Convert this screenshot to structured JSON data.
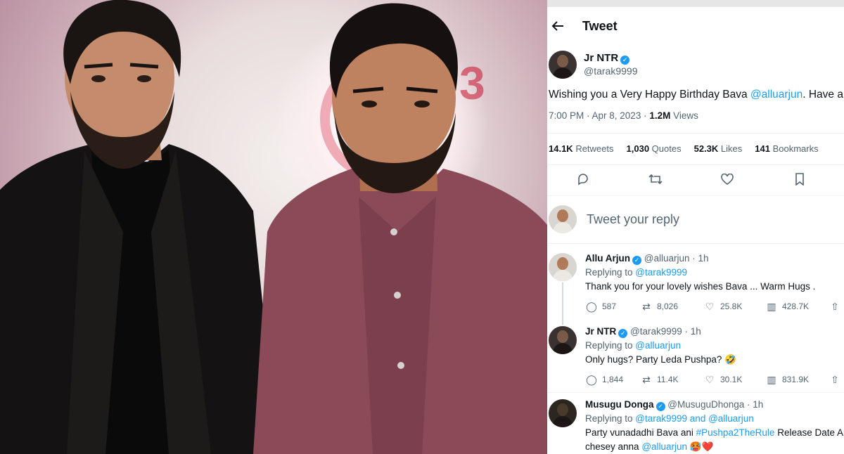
{
  "header": {
    "title": "Tweet"
  },
  "tweet": {
    "author_name": "Jr NTR",
    "author_handle": "@tarak9999",
    "text_prefix": "Wishing you a Very Happy Birthday Bava ",
    "text_mention": "@alluarjun",
    "text_suffix": ". Have a gre",
    "time": "7:00 PM · Apr 8, 2023 · ",
    "views_count": "1.2M",
    "views_label": " Views",
    "stats": {
      "retweets": "14.1K",
      "retweets_label": " Retweets",
      "quotes": "1,030",
      "quotes_label": " Quotes",
      "likes": "52.3K",
      "likes_label": " Likes",
      "bookmarks": "141",
      "bookmarks_label": " Bookmarks"
    }
  },
  "reply_box": {
    "placeholder": "Tweet your reply"
  },
  "replies": [
    {
      "name": "Allu Arjun",
      "handle": "@alluarjun · 1h",
      "replying_prefix": "Replying to ",
      "replying_to": "@tarak9999",
      "text": "Thank you for your lovely wishes Bava ... Warm Hugs .",
      "comments": "587",
      "retweets": "8,026",
      "likes": "25.8K",
      "views": "428.7K"
    },
    {
      "name": "Jr NTR",
      "handle": "@tarak9999 · 1h",
      "replying_prefix": "Replying to ",
      "replying_to": "@alluarjun",
      "text": "Only hugs?  Party Leda Pushpa? 🤣",
      "comments": "1,844",
      "retweets": "11.4K",
      "likes": "30.1K",
      "views": "831.9K"
    },
    {
      "name": "Musugu Donga",
      "handle": "@MusuguDhonga · 1h",
      "replying_prefix": "Replying to ",
      "replying_to": "@tarak9999 and @alluarjun",
      "text_line1_prefix": "Party vunadadhi Bava ani ",
      "text_line1_tag": "#Pushpa2TheRule",
      "text_line1_suffix": " Release Date Ann",
      "text_line2_prefix": "chesey anna ",
      "text_line2_mention": "@alluarjun",
      "text_line2_suffix": " 🥵❤️"
    }
  ],
  "photo": {
    "logo_text": "8.3"
  },
  "colors": {
    "accent": "#1d9bf0",
    "text": "#0f1419",
    "muted": "#536471"
  }
}
